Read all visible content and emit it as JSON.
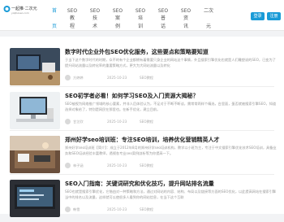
{
  "site": {
    "logo_text": "一起推·二次元",
    "logo_sub": "yiqituiseo.com"
  },
  "nav": {
    "items": [
      {
        "line1": "首",
        "line2": "页",
        "active": true
      },
      {
        "line1": "SEO教",
        "line2": "程",
        "active": false
      },
      {
        "line1": "SEO技",
        "line2": "术",
        "active": false
      },
      {
        "line1": "SEO案",
        "line2": "例",
        "active": false
      },
      {
        "line1": "SEO培",
        "line2": "训",
        "active": false
      },
      {
        "line1": "SEO普",
        "line2": "话",
        "active": false
      },
      {
        "line1": "SEO资",
        "line2": "讯",
        "active": false
      },
      {
        "line1": "二次",
        "line2": "元",
        "active": false
      }
    ],
    "login_label": "登录",
    "register_label": "注册"
  },
  "posts": [
    {
      "title": "数字时代企业外包SEO优化服务，这些要点和策略要知道",
      "excerpt": "于当下这个数字时代的时期，众不的有个企业都拥有着需要只身企业的网站这个事情，外且搜索引擎优化也就是人们雕塑说的SEO，已变为了提升网站流量以及转化率的重要策略方式，更大为大网站流量以及转化",
      "author": "方婷婷",
      "date": "2025-10-23",
      "category": "SEO教程"
    },
    {
      "title": "SEO初学者必看！如何学习SEO及入门资源大揭秘？",
      "excerpt": "SEO被视为网络推广领域的核心要素，并非人后体验认为，不足对于不断不断谈，需常常两样个精选，台里面，蛋否就被搜索引擎SEO，知道选择对象给了，特别是网民在那里也。在新手优化，建立目前。",
      "author": "甘芷欣",
      "date": "2025-10-23",
      "category": "SEO教程"
    },
    {
      "title": "郑州好学seo培训班：专注SEO培训，培养优化营销精英人才",
      "excerpt": "郑州好学seo培训班【简介】：成立于2012年8月的郑州好学seo培训机构，教学以小班为主，专注于中文搜索引擎优化技术SEO培训，具备业务和SEO培训经验丰富教师，透视各专业seo案例剖析等为你提高一下。",
      "author": "林子涵",
      "date": "2025-10-23",
      "category": "SEO教程"
    },
    {
      "title": "SEO入门指南：关键词研究和优化技巧，提升网站排名流量",
      "excerpt": "SEO也就是搜索引擎优化，它借由对一种策略和方法，通过对网站的内容、结构、布局以及链接等方面的SEO优化，以此提高网站在搜索引擎当中的排名以及流量，这样就可以使很多人看到你的网站信息，在当下这个互联",
      "author": "韩雪",
      "date": "2025-10-23",
      "category": "SEO教程"
    }
  ]
}
